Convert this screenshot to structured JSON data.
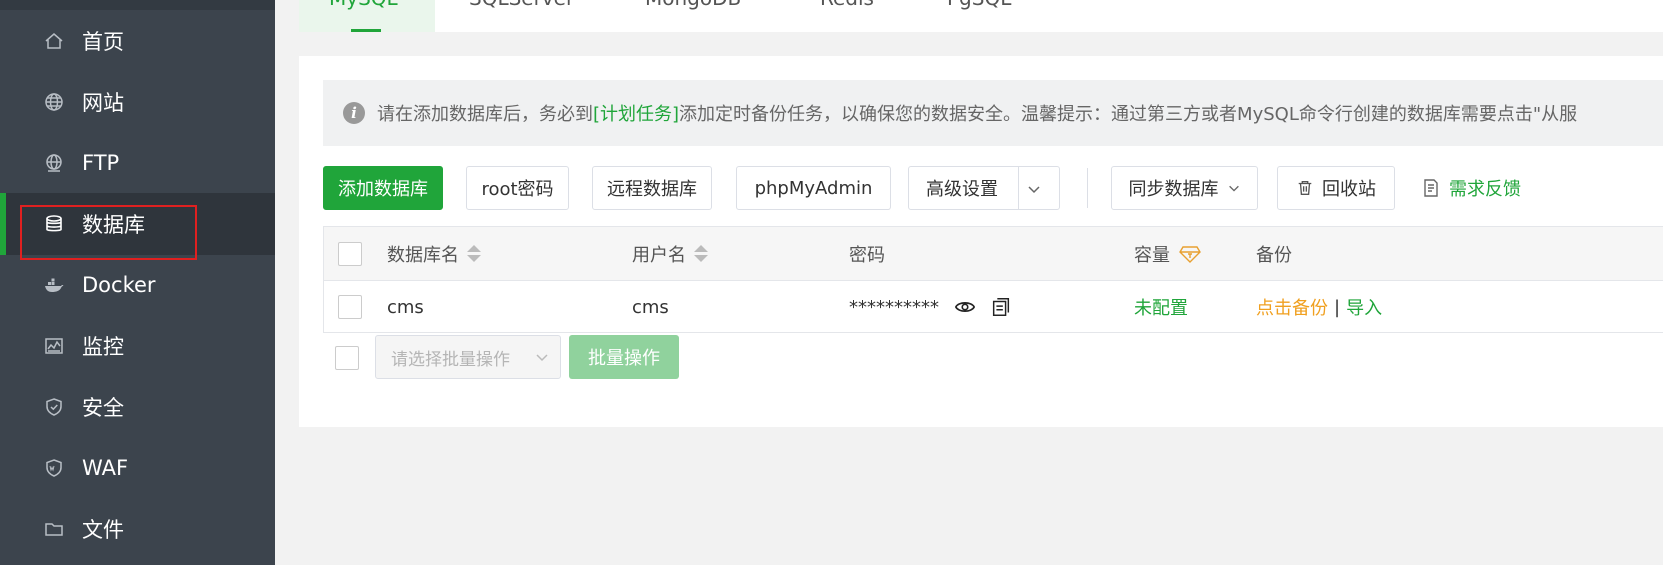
{
  "sidebar": {
    "items": [
      {
        "label": "首页",
        "icon": "home-icon"
      },
      {
        "label": "网站",
        "icon": "globe-icon"
      },
      {
        "label": "FTP",
        "icon": "ftp-globe-icon"
      },
      {
        "label": "数据库",
        "icon": "database-icon",
        "active": true
      },
      {
        "label": "Docker",
        "icon": "docker-icon"
      },
      {
        "label": "监控",
        "icon": "monitor-icon"
      },
      {
        "label": "安全",
        "icon": "shield-icon"
      },
      {
        "label": "WAF",
        "icon": "waf-shield-icon"
      },
      {
        "label": "文件",
        "icon": "folder-icon"
      }
    ]
  },
  "tabs": [
    "MySQL",
    "SQLServer",
    "MongoDB",
    "Redis",
    "PgSQL"
  ],
  "alert": {
    "prefix": "请在添加数据库后，务必到",
    "link": "[计划任务]",
    "suffix": "添加定时备份任务，以确保您的数据安全。温馨提示：通过第三方或者MySQL命令行创建的数据库需要点击\"从服"
  },
  "toolbar": {
    "add_db": "添加数据库",
    "root_pwd": "root密码",
    "remote_db": "远程数据库",
    "phpmyadmin": "phpMyAdmin",
    "advanced": "高级设置",
    "sync_db": "同步数据库",
    "recycle": "回收站",
    "feedback": "需求反馈"
  },
  "table": {
    "headers": {
      "name": "数据库名",
      "user": "用户名",
      "password": "密码",
      "capacity": "容量",
      "backup": "备份"
    },
    "rows": [
      {
        "name": "cms",
        "user": "cms",
        "password": "**********",
        "capacity": "未配置",
        "backup_action": "点击备份",
        "separator": "|",
        "import_action": "导入"
      }
    ]
  },
  "batch": {
    "placeholder": "请选择批量操作",
    "button": "批量操作"
  },
  "colors": {
    "accent": "#20a53a",
    "sidebar": "#3c444d",
    "warning": "#f0a020",
    "highlight": "#e02020"
  }
}
